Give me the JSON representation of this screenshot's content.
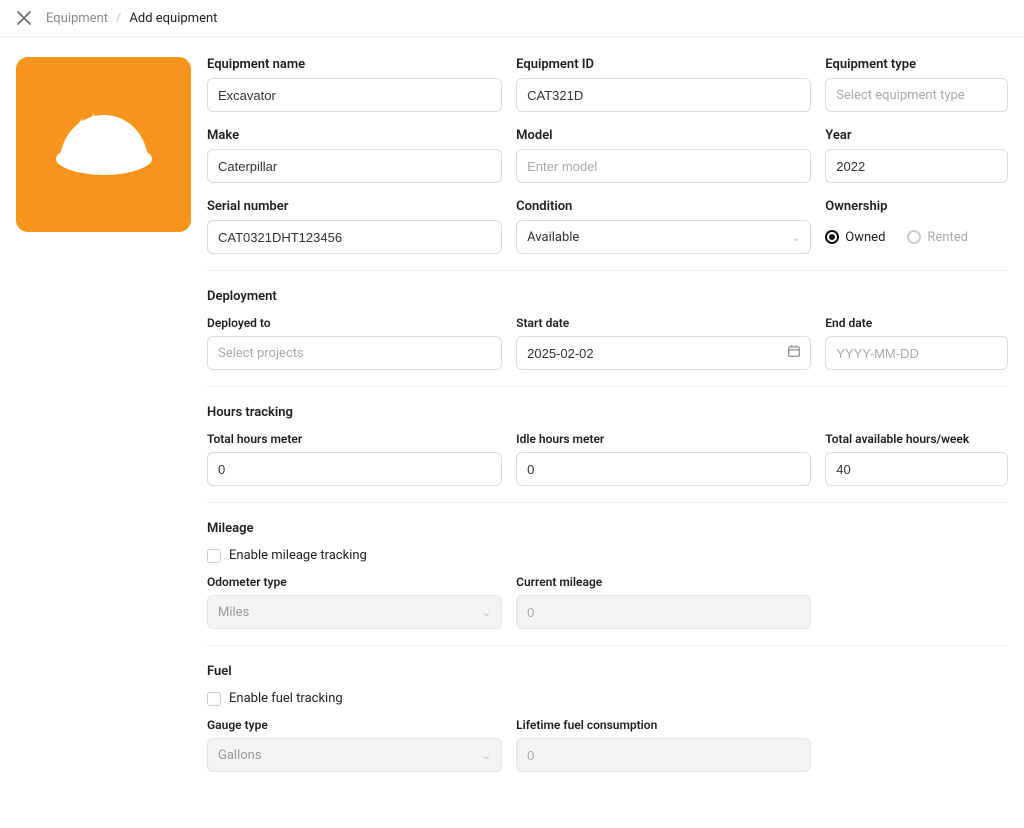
{
  "header": {
    "breadcrumb_root": "Equipment",
    "breadcrumb_sep": "/",
    "breadcrumb_current": "Add equipment"
  },
  "fields": {
    "equipment_name": {
      "label": "Equipment name",
      "value": "Excavator"
    },
    "equipment_id": {
      "label": "Equipment ID",
      "value": "CAT321D"
    },
    "equipment_type": {
      "label": "Equipment type",
      "placeholder": "Select equipment type"
    },
    "make": {
      "label": "Make",
      "value": "Caterpillar"
    },
    "model": {
      "label": "Model",
      "placeholder": "Enter model"
    },
    "year": {
      "label": "Year",
      "value": "2022"
    },
    "serial_number": {
      "label": "Serial number",
      "value": "CAT0321DHT123456"
    },
    "condition": {
      "label": "Condition",
      "value": "Available"
    },
    "ownership": {
      "label": "Ownership",
      "option_owned": "Owned",
      "option_rented": "Rented"
    }
  },
  "deployment": {
    "section_title": "Deployment",
    "deployed_to": {
      "label": "Deployed to",
      "placeholder": "Select projects"
    },
    "start_date": {
      "label": "Start date",
      "value": "2025-02-02"
    },
    "end_date": {
      "label": "End date",
      "placeholder": "YYYY-MM-DD"
    }
  },
  "hours": {
    "section_title": "Hours tracking",
    "total_hours": {
      "label": "Total hours meter",
      "value": "0"
    },
    "idle_hours": {
      "label": "Idle hours meter",
      "value": "0"
    },
    "available_hours": {
      "label": "Total available hours/week",
      "value": "40"
    }
  },
  "mileage": {
    "section_title": "Mileage",
    "enable_label": "Enable mileage tracking",
    "odometer_type": {
      "label": "Odometer type",
      "value": "Miles"
    },
    "current_mileage": {
      "label": "Current mileage",
      "placeholder": "0"
    }
  },
  "fuel": {
    "section_title": "Fuel",
    "enable_label": "Enable fuel tracking",
    "gauge_type": {
      "label": "Gauge type",
      "value": "Gallons"
    },
    "lifetime_consumption": {
      "label": "Lifetime fuel consumption",
      "placeholder": "0"
    }
  }
}
